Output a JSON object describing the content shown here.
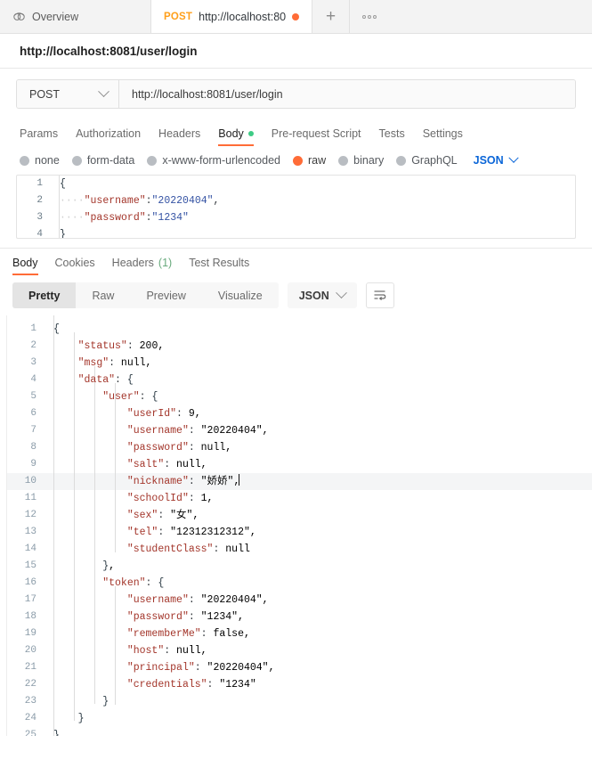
{
  "window": {
    "tabs": [
      {
        "label": "Overview",
        "icon": "overview-icon",
        "active": false
      },
      {
        "method": "POST",
        "label": "http://localhost:80",
        "active": true,
        "unsaved": true
      }
    ],
    "new_tab_label": "+",
    "more_label": "•••"
  },
  "request_name": "http://localhost:8081/user/login",
  "urlbar": {
    "method": "POST",
    "url": "http://localhost:8081/user/login"
  },
  "request_tabs": [
    {
      "label": "Params",
      "active": false
    },
    {
      "label": "Authorization",
      "active": false
    },
    {
      "label": "Headers",
      "active": false
    },
    {
      "label": "Body",
      "active": true,
      "indicator": "green-dot"
    },
    {
      "label": "Pre-request Script",
      "active": false
    },
    {
      "label": "Tests",
      "active": false
    },
    {
      "label": "Settings",
      "active": false
    }
  ],
  "body_types": [
    {
      "label": "none",
      "selected": false
    },
    {
      "label": "form-data",
      "selected": false
    },
    {
      "label": "x-www-form-urlencoded",
      "selected": false
    },
    {
      "label": "raw",
      "selected": true
    },
    {
      "label": "binary",
      "selected": false
    },
    {
      "label": "GraphQL",
      "selected": false
    }
  ],
  "body_format": "JSON",
  "request_body_lines": [
    {
      "n": "1",
      "content": "{"
    },
    {
      "n": "2",
      "content": "    \"username\":\"20220404\","
    },
    {
      "n": "3",
      "content": "    \"password\":\"1234\""
    },
    {
      "n": "4",
      "content": "}"
    }
  ],
  "response_tabs": [
    {
      "label": "Body",
      "active": true
    },
    {
      "label": "Cookies",
      "active": false
    },
    {
      "label": "Headers",
      "count": "(1)",
      "active": false
    },
    {
      "label": "Test Results",
      "active": false
    }
  ],
  "response_views": [
    {
      "label": "Pretty",
      "active": true
    },
    {
      "label": "Raw",
      "active": false
    },
    {
      "label": "Preview",
      "active": false
    },
    {
      "label": "Visualize",
      "active": false
    }
  ],
  "response_format": "JSON",
  "wrap_icon": "word-wrap-icon",
  "response_body_lines": [
    {
      "n": "1",
      "indent": 0,
      "text": "{"
    },
    {
      "n": "2",
      "indent": 1,
      "text": "\"status\": 200,"
    },
    {
      "n": "3",
      "indent": 1,
      "text": "\"msg\": null,"
    },
    {
      "n": "4",
      "indent": 1,
      "text": "\"data\": {"
    },
    {
      "n": "5",
      "indent": 2,
      "text": "\"user\": {"
    },
    {
      "n": "6",
      "indent": 3,
      "text": "\"userId\": 9,"
    },
    {
      "n": "7",
      "indent": 3,
      "text": "\"username\": \"20220404\","
    },
    {
      "n": "8",
      "indent": 3,
      "text": "\"password\": null,"
    },
    {
      "n": "9",
      "indent": 3,
      "text": "\"salt\": null,"
    },
    {
      "n": "10",
      "indent": 3,
      "text": "\"nickname\": \"娇娇\",",
      "highlighted": true,
      "caret": true
    },
    {
      "n": "11",
      "indent": 3,
      "text": "\"schoolId\": 1,"
    },
    {
      "n": "12",
      "indent": 3,
      "text": "\"sex\": \"女\","
    },
    {
      "n": "13",
      "indent": 3,
      "text": "\"tel\": \"12312312312\","
    },
    {
      "n": "14",
      "indent": 3,
      "text": "\"studentClass\": null"
    },
    {
      "n": "15",
      "indent": 2,
      "text": "},"
    },
    {
      "n": "16",
      "indent": 2,
      "text": "\"token\": {"
    },
    {
      "n": "17",
      "indent": 3,
      "text": "\"username\": \"20220404\","
    },
    {
      "n": "18",
      "indent": 3,
      "text": "\"password\": \"1234\","
    },
    {
      "n": "19",
      "indent": 3,
      "text": "\"rememberMe\": false,"
    },
    {
      "n": "20",
      "indent": 3,
      "text": "\"host\": null,"
    },
    {
      "n": "21",
      "indent": 3,
      "text": "\"principal\": \"20220404\","
    },
    {
      "n": "22",
      "indent": 3,
      "text": "\"credentials\": \"1234\""
    },
    {
      "n": "23",
      "indent": 2,
      "text": "}"
    },
    {
      "n": "24",
      "indent": 1,
      "text": "}"
    },
    {
      "n": "25",
      "indent": 0,
      "text": "}"
    }
  ],
  "colors": {
    "accent": "#ff6c37",
    "method_post": "#ff9f1a",
    "json_key": "#a3352a",
    "json_string": "#3553a4",
    "json_literal": "#1c3e72",
    "link_blue": "#0b66d8",
    "green_dot": "#3ecb85"
  }
}
